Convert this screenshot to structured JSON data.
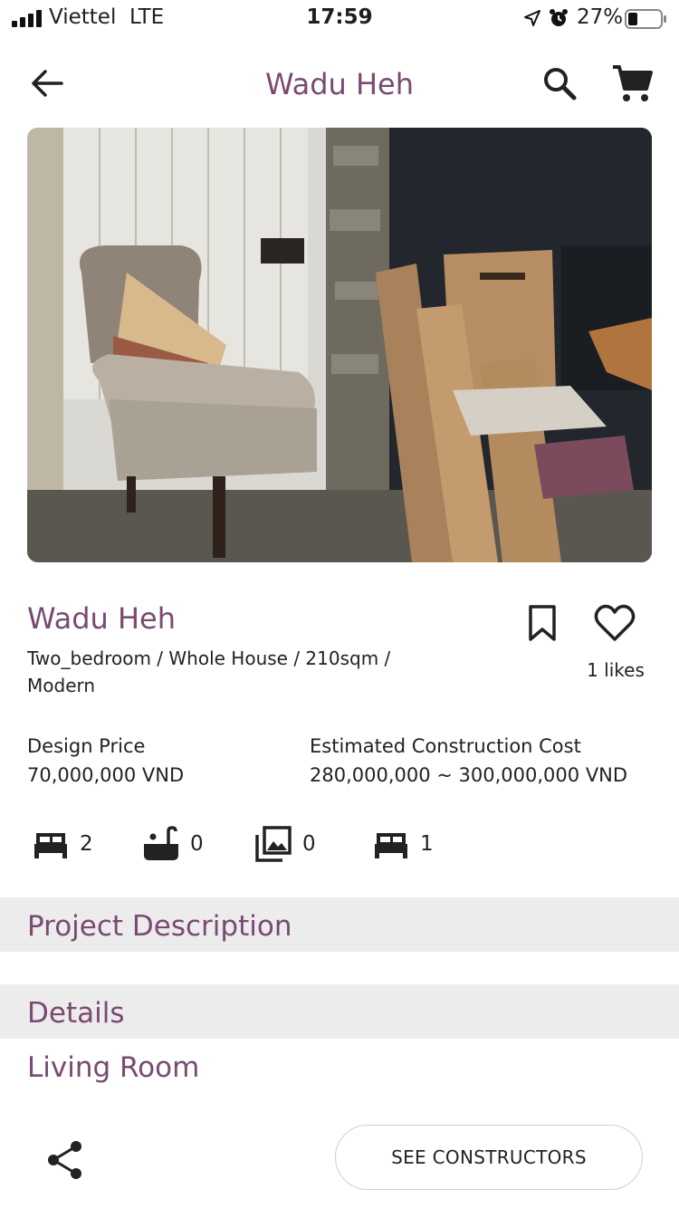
{
  "status_bar": {
    "carrier": "Viettel",
    "network": "LTE",
    "time": "17:59",
    "battery": "27%"
  },
  "header": {
    "title": "Wadu Heh",
    "back_icon": "arrow-left-icon",
    "search_icon": "search-icon",
    "cart_icon": "cart-icon"
  },
  "project": {
    "name": "Wadu Heh",
    "specs": "Two_bedroom / Whole House / 210sqm / Modern",
    "likes": "1 likes",
    "bookmark_icon": "bookmark-icon",
    "like_icon": "heart-icon"
  },
  "pricing": {
    "design_label": "Design Price",
    "design_value": "70,000,000 VND",
    "construction_label": "Estimated Construction Cost",
    "construction_value": "280,000,000 ~ 300,000,000 VND"
  },
  "amenities": [
    {
      "icon": "bed-icon",
      "count": "2"
    },
    {
      "icon": "bathtub-icon",
      "count": "0"
    },
    {
      "icon": "gallery-icon",
      "count": "0"
    },
    {
      "icon": "bed-icon",
      "count": "1"
    }
  ],
  "sections": {
    "project_description": "Project Description",
    "details": "Details",
    "living_room": "Living Room"
  },
  "bottom": {
    "share_icon": "share-icon",
    "cta_label": "SEE CONSTRUCTORS"
  },
  "colors": {
    "accent": "#7a4a72",
    "band": "#ececec"
  }
}
